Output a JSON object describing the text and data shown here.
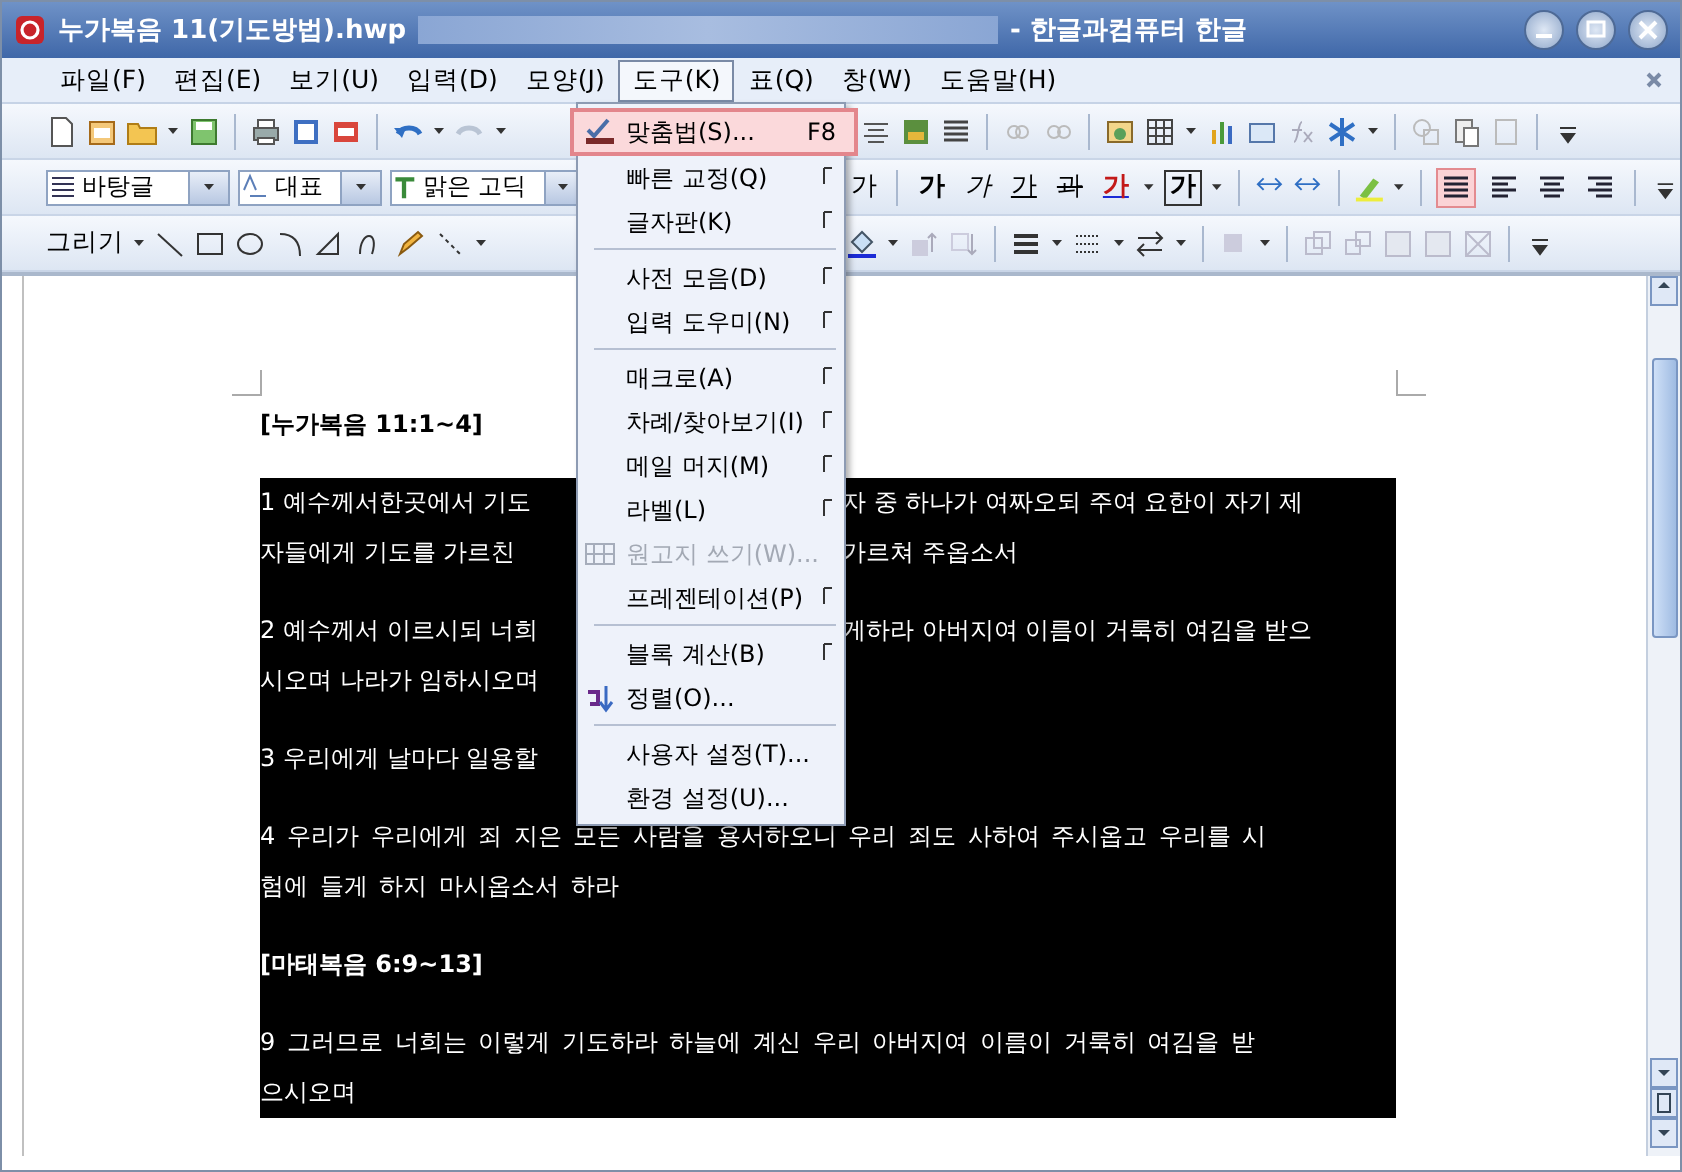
{
  "window": {
    "title": "누가복음 11(기도방법).hwp",
    "app_name": "- 한글과컴퓨터 한글"
  },
  "menu_bar": [
    {
      "label": "파일(F)",
      "open": false
    },
    {
      "label": "편집(E)",
      "open": false
    },
    {
      "label": "보기(U)",
      "open": false
    },
    {
      "label": "입력(D)",
      "open": false
    },
    {
      "label": "모양(J)",
      "open": false
    },
    {
      "label": "도구(K)",
      "open": true
    },
    {
      "label": "표(Q)",
      "open": false
    },
    {
      "label": "창(W)",
      "open": false
    },
    {
      "label": "도움말(H)",
      "open": false
    }
  ],
  "format_bar": {
    "style": "바탕글",
    "char_style": "대표",
    "font": "맑은 고딕",
    "text_buttons": [
      {
        "text": "가",
        "kind": "grow",
        "pressed": false
      },
      {
        "text": "가",
        "kind": "bold",
        "pressed": false
      },
      {
        "text": "가",
        "kind": "italic",
        "pressed": false
      },
      {
        "text": "가",
        "kind": "underline",
        "pressed": false
      },
      {
        "text": "과",
        "kind": "strike",
        "pressed": false
      },
      {
        "text": "가",
        "kind": "color",
        "pressed": false
      },
      {
        "text": "가",
        "kind": "boxed",
        "pressed": false
      }
    ],
    "align": [
      {
        "kind": "justify",
        "selected": true
      },
      {
        "kind": "left",
        "selected": false
      },
      {
        "kind": "center",
        "selected": false
      },
      {
        "kind": "right",
        "selected": false
      }
    ]
  },
  "drawing_bar": {
    "label": "그리기"
  },
  "tools_menu": [
    {
      "kind": "spell",
      "label": "맞춤법(S)...",
      "shortcut": "F8",
      "selected": true,
      "submenu": false,
      "disabled": false
    },
    {
      "kind": "plain",
      "label": "빠른 교정(Q)",
      "selected": false,
      "submenu": true,
      "disabled": false
    },
    {
      "kind": "plain",
      "label": "글자판(K)",
      "selected": false,
      "submenu": true,
      "disabled": false
    },
    {
      "kind": "separator"
    },
    {
      "kind": "plain",
      "label": "사전 모음(D)",
      "selected": false,
      "submenu": true,
      "disabled": false
    },
    {
      "kind": "plain",
      "label": "입력 도우미(N)",
      "selected": false,
      "submenu": true,
      "disabled": false
    },
    {
      "kind": "separator"
    },
    {
      "kind": "plain",
      "label": "매크로(A)",
      "selected": false,
      "submenu": true,
      "disabled": false
    },
    {
      "kind": "plain",
      "label": "차례/찾아보기(I)",
      "selected": false,
      "submenu": true,
      "disabled": false
    },
    {
      "kind": "plain",
      "label": "메일 머지(M)",
      "selected": false,
      "submenu": true,
      "disabled": false
    },
    {
      "kind": "plain",
      "label": "라벨(L)",
      "selected": false,
      "submenu": true,
      "disabled": false
    },
    {
      "kind": "grid",
      "label": "원고지 쓰기(W)...",
      "selected": false,
      "submenu": false,
      "disabled": true
    },
    {
      "kind": "plain",
      "label": "프레젠테이션(P)",
      "selected": false,
      "submenu": true,
      "disabled": false
    },
    {
      "kind": "separator"
    },
    {
      "kind": "plain",
      "label": "블록 계산(B)",
      "selected": false,
      "submenu": true,
      "disabled": false
    },
    {
      "kind": "sort",
      "label": "정렬(O)...",
      "selected": false,
      "submenu": false,
      "disabled": false
    },
    {
      "kind": "separator"
    },
    {
      "kind": "plain",
      "label": "사용자 설정(T)...",
      "selected": false,
      "submenu": false,
      "disabled": false
    },
    {
      "kind": "plain",
      "label": "환경 설정(U)...",
      "selected": false,
      "submenu": false,
      "disabled": false
    }
  ],
  "document": [
    {
      "kind": "heading",
      "text": "[누가복음  11:1~4]",
      "selected": false
    },
    {
      "kind": "gap",
      "selected": false
    },
    {
      "kind": "line",
      "left": "1 예수께서한곳에서 기도",
      "right": "자 중 하나가 여짜오되 주여 요한이 자기 제",
      "selected": true
    },
    {
      "kind": "line",
      "left": "자들에게 기도를 가르친",
      "right": "가르쳐 주옵소서",
      "selected": true
    },
    {
      "kind": "gap",
      "selected": true
    },
    {
      "kind": "line",
      "left": "2 예수께서 이르시되 너희",
      "right": "게하라 아버지여 이름이 거룩히 여김을 받으",
      "selected": true
    },
    {
      "kind": "line",
      "left": "시오며 나라가 임하시오며",
      "selected": true
    },
    {
      "kind": "gap",
      "selected": true
    },
    {
      "kind": "line",
      "left": "3 우리에게 날마다 일용할",
      "selected": true
    },
    {
      "kind": "gap",
      "selected": true
    },
    {
      "kind": "line",
      "text": "4 우리가 우리에게 죄 지은 모든 사람을 용서하오니 우리 죄도 사하여 주시옵고 우리를 시",
      "selected": true
    },
    {
      "kind": "line",
      "text": "험에 들게 하지 마시옵소서 하라",
      "selected": true
    },
    {
      "kind": "gap",
      "selected": true
    },
    {
      "kind": "heading",
      "text": "[마태복음  6:9~13]",
      "selected": true
    },
    {
      "kind": "gap",
      "selected": true
    },
    {
      "kind": "line",
      "text": "9 그러므로 너희는 이렇게 기도하라 하늘에 계신 우리 아버지여 이름이 거룩히 여김을 받",
      "selected": true
    },
    {
      "kind": "line",
      "text": "으시오며",
      "selected": true
    }
  ]
}
